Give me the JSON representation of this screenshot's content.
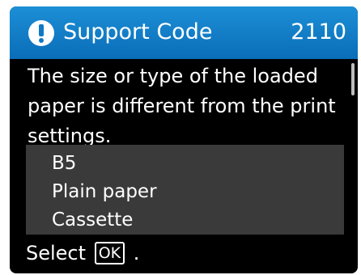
{
  "header": {
    "icon": "alert-exclamation-icon",
    "title": "Support Code",
    "code": "2110"
  },
  "message": "The size or type of the loaded paper is different from the print settings.",
  "details": {
    "paper_size": "B5",
    "media_type": "Plain paper",
    "source": "Cassette"
  },
  "footer": {
    "prefix": "Select",
    "key_label": "OK",
    "suffix": "."
  },
  "colors": {
    "header_bg": "#0f79c4",
    "screen_bg": "#000000",
    "details_bg": "#3a3a3a",
    "text": "#ffffff"
  }
}
